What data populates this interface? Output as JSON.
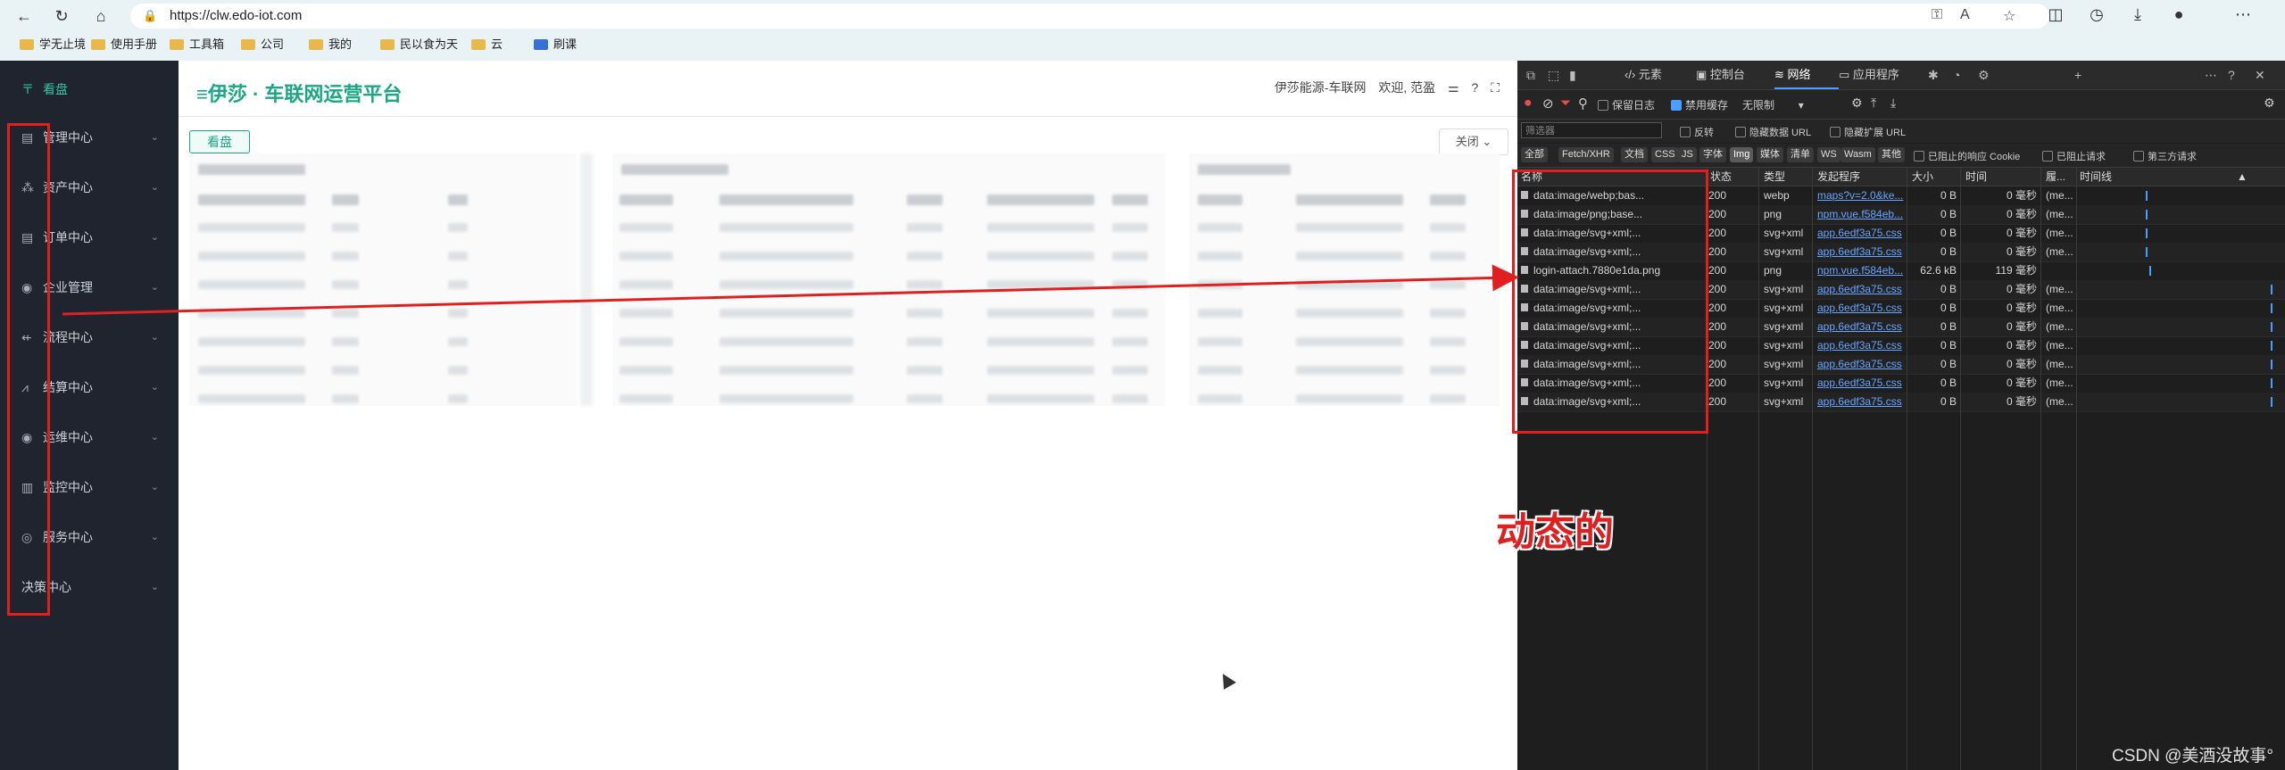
{
  "browser": {
    "url": "https://clw.edo-iot.com",
    "bookmarks": [
      "学无止境",
      "使用手册",
      "工具箱",
      "公司",
      "我的",
      "民以食为天",
      "云",
      "刷课"
    ]
  },
  "sidebar": {
    "items": [
      {
        "label": "看盘"
      },
      {
        "label": "管理中心"
      },
      {
        "label": "资产中心"
      },
      {
        "label": "订单中心"
      },
      {
        "label": "企业管理"
      },
      {
        "label": "流程中心"
      },
      {
        "label": "结算中心"
      },
      {
        "label": "运维中心"
      },
      {
        "label": "监控中心"
      },
      {
        "label": "服务中心"
      },
      {
        "label": "决策中心"
      }
    ]
  },
  "header": {
    "brand": "≡伊莎 · 车联网运营平台",
    "org": "伊莎能源-车联网",
    "welcome": "欢迎, 范盈",
    "kanban_tab": "看盘",
    "close_btn": "关闭 ⌄"
  },
  "devtools": {
    "tabs": [
      "元素",
      "控制台",
      "网络",
      "应用程序"
    ],
    "toolbar2": {
      "preserve_log": "保留日志",
      "disable_cache": "禁用缓存",
      "throttle": "无限制"
    },
    "toolbar3": {
      "filter_placeholder": "筛选器",
      "invert": "反转",
      "hide_data_url": "隐藏数据 URL",
      "hide_ext_url": "隐藏扩展 URL"
    },
    "type_filters": [
      "全部",
      "Fetch/XHR",
      "文档",
      "CSS",
      "JS",
      "字体",
      "Img",
      "媒体",
      "清单",
      "WS",
      "Wasm",
      "其他"
    ],
    "toolbar4_extra": {
      "blocked_cookie": "已阻止的响应 Cookie",
      "blocked_req": "已阻止请求",
      "third_party": "第三方请求"
    },
    "columns": [
      "名称",
      "状态",
      "类型",
      "发起程序",
      "大小",
      "时间",
      "履...",
      "时间线"
    ],
    "rows": [
      {
        "name": "data:image/webp;bas...",
        "status": "200",
        "type": "webp",
        "initiator": "maps?v=2.0&ke...",
        "size": "0 B",
        "time": "0 毫秒",
        "extra": "(me..."
      },
      {
        "name": "data:image/png;base...",
        "status": "200",
        "type": "png",
        "initiator": "npm.vue.f584eb...",
        "size": "0 B",
        "time": "0 毫秒",
        "extra": "(me..."
      },
      {
        "name": "data:image/svg+xml;...",
        "status": "200",
        "type": "svg+xml",
        "initiator": "app.6edf3a75.css",
        "size": "0 B",
        "time": "0 毫秒",
        "extra": "(me..."
      },
      {
        "name": "data:image/svg+xml;...",
        "status": "200",
        "type": "svg+xml",
        "initiator": "app.6edf3a75.css",
        "size": "0 B",
        "time": "0 毫秒",
        "extra": "(me..."
      },
      {
        "name": "login-attach.7880e1da.png",
        "status": "200",
        "type": "png",
        "initiator": "npm.vue.f584eb...",
        "size": "62.6 kB",
        "time": "119 毫秒",
        "extra": ""
      },
      {
        "name": "data:image/svg+xml;...",
        "status": "200",
        "type": "svg+xml",
        "initiator": "app.6edf3a75.css",
        "size": "0 B",
        "time": "0 毫秒",
        "extra": "(me..."
      },
      {
        "name": "data:image/svg+xml;...",
        "status": "200",
        "type": "svg+xml",
        "initiator": "app.6edf3a75.css",
        "size": "0 B",
        "time": "0 毫秒",
        "extra": "(me..."
      },
      {
        "name": "data:image/svg+xml;...",
        "status": "200",
        "type": "svg+xml",
        "initiator": "app.6edf3a75.css",
        "size": "0 B",
        "time": "0 毫秒",
        "extra": "(me..."
      },
      {
        "name": "data:image/svg+xml;...",
        "status": "200",
        "type": "svg+xml",
        "initiator": "app.6edf3a75.css",
        "size": "0 B",
        "time": "0 毫秒",
        "extra": "(me..."
      },
      {
        "name": "data:image/svg+xml;...",
        "status": "200",
        "type": "svg+xml",
        "initiator": "app.6edf3a75.css",
        "size": "0 B",
        "time": "0 毫秒",
        "extra": "(me..."
      },
      {
        "name": "data:image/svg+xml;...",
        "status": "200",
        "type": "svg+xml",
        "initiator": "app.6edf3a75.css",
        "size": "0 B",
        "time": "0 毫秒",
        "extra": "(me..."
      },
      {
        "name": "data:image/svg+xml;...",
        "status": "200",
        "type": "svg+xml",
        "initiator": "app.6edf3a75.css",
        "size": "0 B",
        "time": "0 毫秒",
        "extra": "(me..."
      }
    ]
  },
  "annotation": {
    "label": "动态的"
  },
  "watermark": "CSDN @美酒没故事°",
  "colors": {
    "sidebar_bg": "#1f242e",
    "brand": "#1ba784",
    "annotation_red": "#e02020",
    "devtools_bg": "#1e1e1e",
    "link": "#6aa5ff"
  }
}
